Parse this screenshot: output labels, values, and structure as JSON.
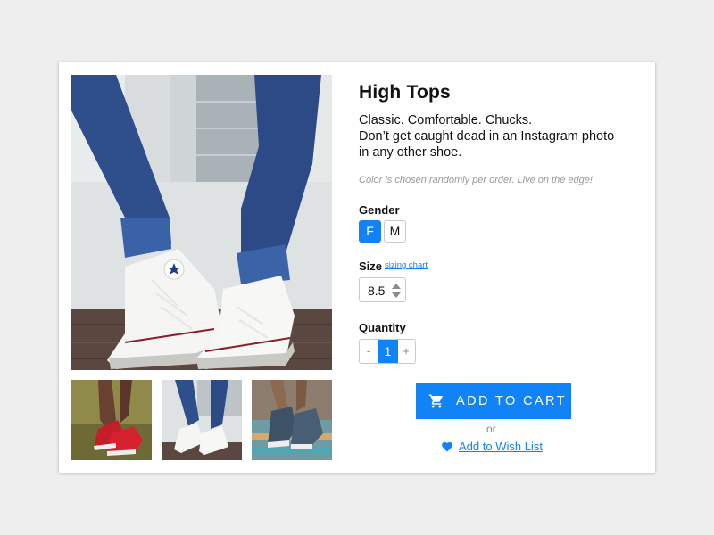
{
  "product": {
    "title": "High Tops",
    "description_lines": [
      "Classic. Comfortable. Chucks.",
      "Don’t get caught dead in an Instagram photo",
      "in any other shoe."
    ],
    "note": "Color is chosen randomly per order. Live on the edge!"
  },
  "gender": {
    "label": "Gender",
    "options": [
      "F",
      "M"
    ],
    "selected": "F"
  },
  "size": {
    "label": "Size",
    "link_text": "sizing chart",
    "value": "8.5"
  },
  "quantity": {
    "label": "Quantity",
    "minus": "-",
    "value": "1",
    "plus": "+"
  },
  "actions": {
    "add_to_cart": "ADD TO CART",
    "or_text": "or",
    "wishlist": "Add to Wish List"
  },
  "images": {
    "main": "white-high-tops-jeans-photo",
    "thumbnails": [
      "red-high-tops-grass-photo",
      "white-high-tops-porch-photo",
      "denim-high-tops-stairs-photo"
    ]
  },
  "icons": {
    "cart": "cart-icon",
    "heart": "heart-icon",
    "size_arrows": "updown-arrows-icon"
  },
  "colors": {
    "accent": "#1183f6",
    "background": "#eeeeee",
    "card": "#ffffff",
    "muted_text": "#999999"
  }
}
